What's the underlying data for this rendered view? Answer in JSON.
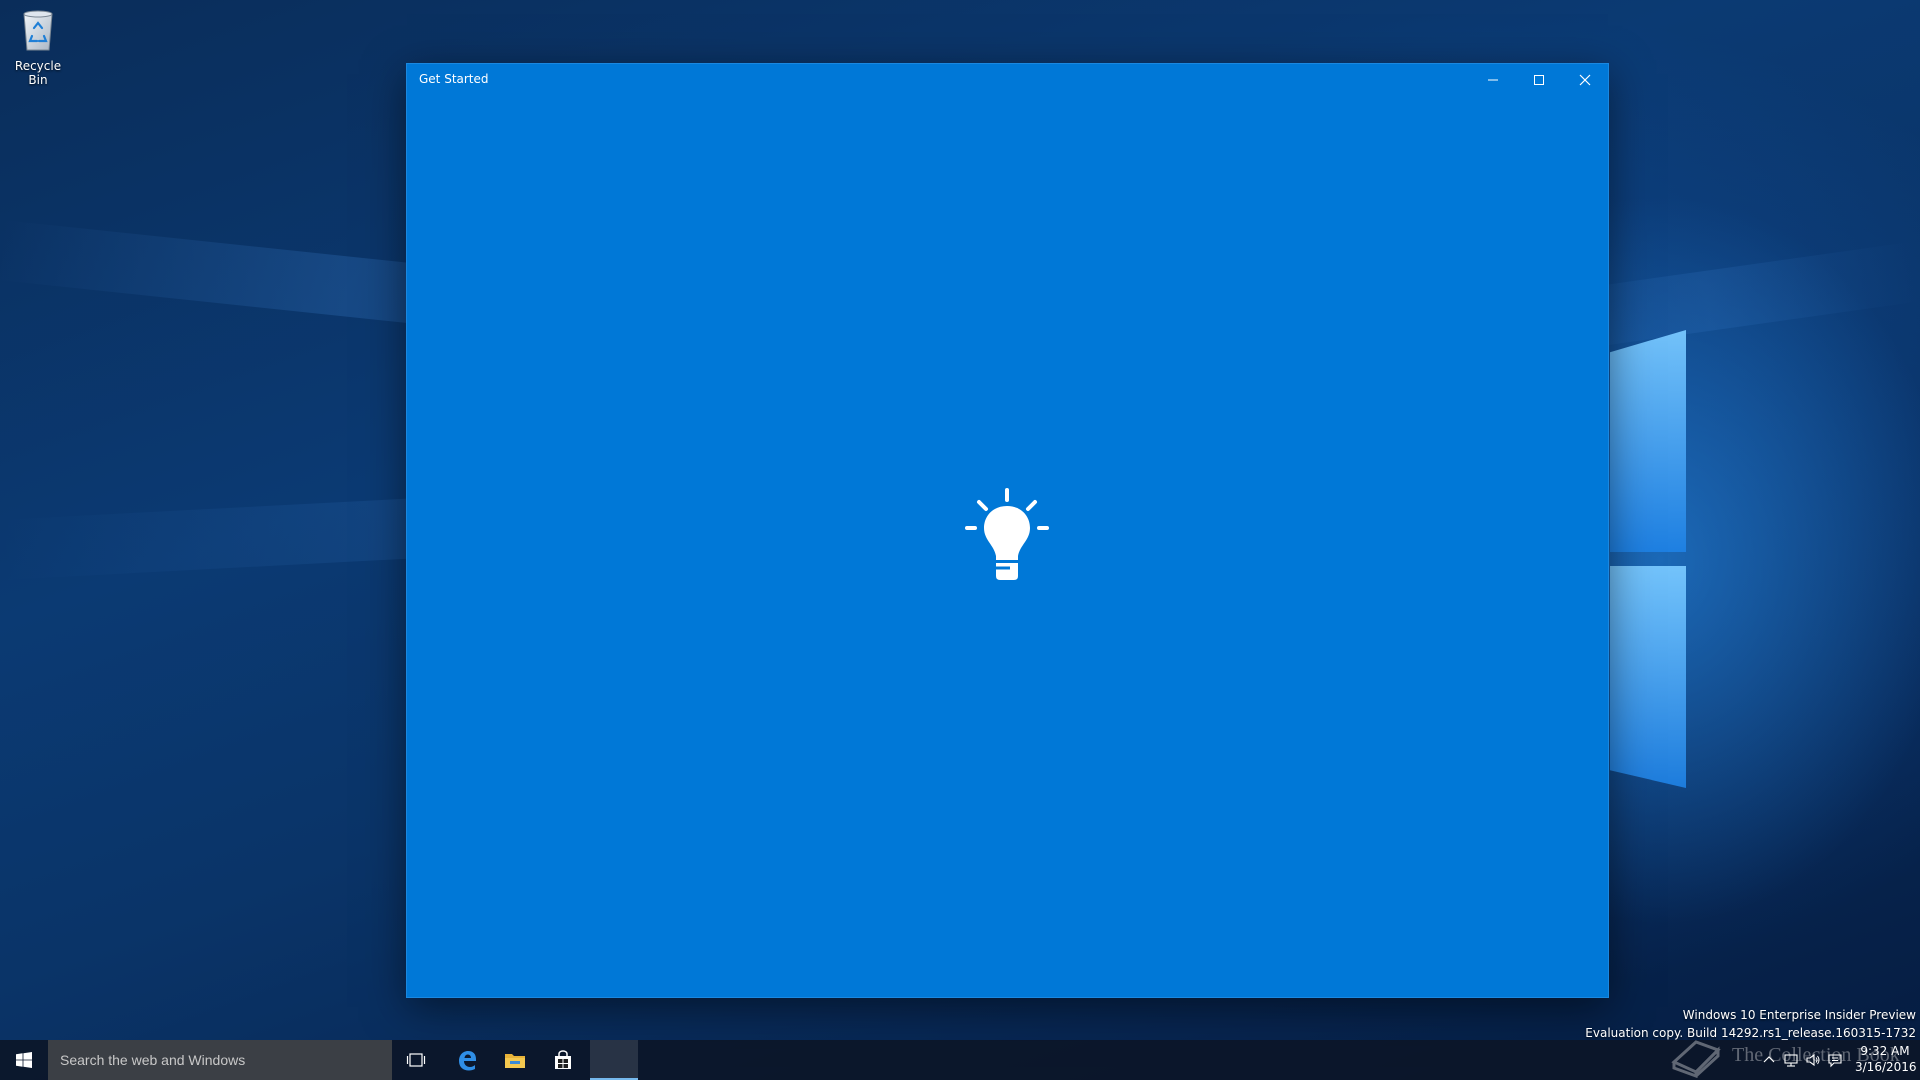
{
  "desktop": {
    "recycle_bin_label": "Recycle Bin"
  },
  "window": {
    "title": "Get Started",
    "background_color": "#0078d7",
    "splash_icon": "lightbulb-icon",
    "controls": {
      "minimize": "minimize-icon",
      "maximize": "maximize-icon",
      "close": "close-icon"
    }
  },
  "watermark": {
    "line1": "Windows 10 Enterprise Insider Preview",
    "line2": "Evaluation copy. Build 14292.rs1_release.160315-1732"
  },
  "taskbar": {
    "search_placeholder": "Search the web and Windows",
    "pinned": [
      "task-view-icon",
      "edge-icon",
      "file-explorer-icon",
      "store-icon"
    ],
    "active_app": "Get Started",
    "accent_color": "#76b9ed"
  },
  "tray": {
    "time": "9:32 AM",
    "date": "3/16/2016",
    "icons": [
      "chevron-up-icon",
      "network-icon",
      "volume-icon",
      "action-center-icon"
    ]
  },
  "brand_watermark": {
    "text": "The Collection Book"
  }
}
